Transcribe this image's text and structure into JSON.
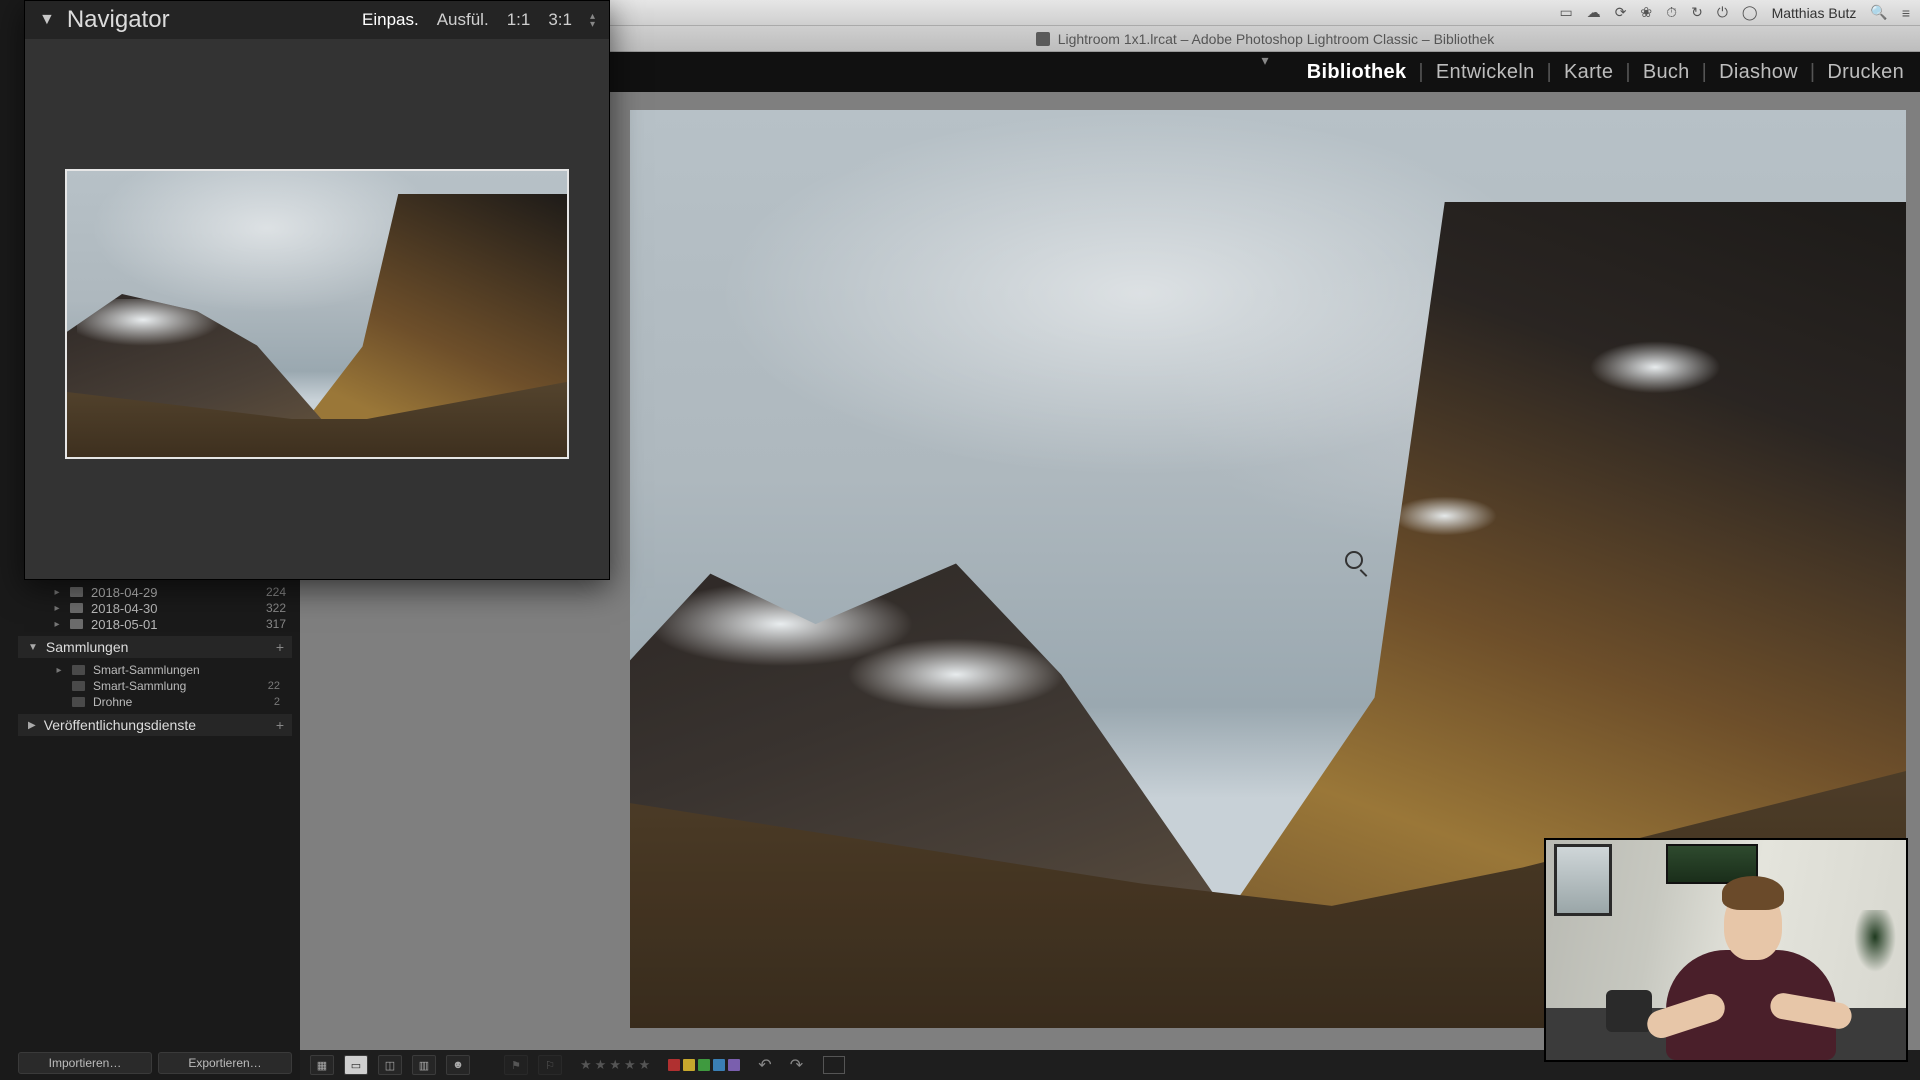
{
  "menubar": {
    "username": "Matthias Butz"
  },
  "window": {
    "title": "Lightroom 1x1.lrcat – Adobe Photoshop Lightroom Classic – Bibliothek"
  },
  "modules": {
    "items": [
      "Bibliothek",
      "Entwickeln",
      "Karte",
      "Buch",
      "Diashow",
      "Drucken"
    ],
    "active_index": 0
  },
  "navigator": {
    "title": "Navigator",
    "zoom_modes": {
      "fit": "Einpas.",
      "fill": "Ausfül.",
      "one": "1:1",
      "ratio": "3:1"
    },
    "active_zoom": "fit"
  },
  "folders": {
    "items": [
      {
        "name": "2018-04-29",
        "count": 224
      },
      {
        "name": "2018-04-30",
        "count": 322
      },
      {
        "name": "2018-05-01",
        "count": 317
      }
    ]
  },
  "collections": {
    "header": "Sammlungen",
    "items": [
      {
        "name": "Smart-Sammlungen",
        "count": ""
      },
      {
        "name": "Smart-Sammlung",
        "count": "22"
      },
      {
        "name": "Drohne",
        "count": "2"
      }
    ]
  },
  "publish": {
    "header": "Veröffentlichungsdienste"
  },
  "buttons": {
    "import": "Importieren…",
    "export": "Exportieren…"
  },
  "toolbar": {
    "color_swatches": [
      "#b03030",
      "#c7a82d",
      "#3f9a3f",
      "#3a7fb5",
      "#7a5fae"
    ]
  }
}
